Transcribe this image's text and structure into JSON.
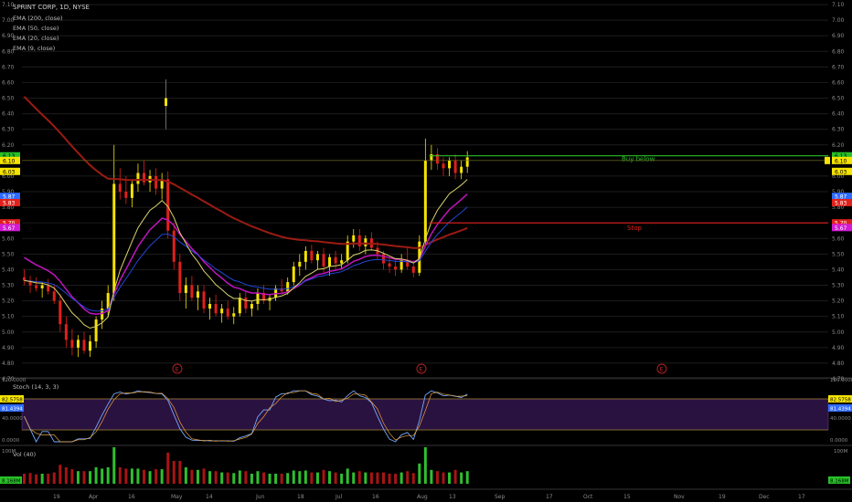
{
  "header": {
    "title": "SPRINT CORP, 1D, NYSE",
    "indicators": [
      "EMA (200, close)",
      "EMA (50, close)",
      "EMA (20, close)",
      "EMA (9, close)"
    ]
  },
  "price_axis": {
    "ticks": [
      "7.10",
      "7.00",
      "6.90",
      "6.80",
      "6.70",
      "6.60",
      "6.50",
      "6.40",
      "6.30",
      "6.20",
      "6.10",
      "6.00",
      "5.90",
      "5.80",
      "5.70",
      "5.60",
      "5.50",
      "5.40",
      "5.30",
      "5.20",
      "5.10",
      "5.00",
      "4.90",
      "4.80",
      "4.70"
    ],
    "markers": [
      {
        "text": "6.13",
        "color": "#27c127"
      },
      {
        "text": "6.10",
        "color": "#f5e300"
      },
      {
        "text": "6.03",
        "color": "#f5e300"
      },
      {
        "text": "5.87",
        "color": "#2f6bff"
      },
      {
        "text": "5.83",
        "color": "#e0201b"
      },
      {
        "text": "5.70",
        "color": "#e0201b"
      },
      {
        "text": "5.67",
        "color": "#d21bd2"
      }
    ]
  },
  "annotations": {
    "buy": "Buy below",
    "stop": "Stop",
    "earnings": "E"
  },
  "stoch": {
    "label": "Stoch (14, 3, 3)",
    "ticks": [
      "120.0000",
      "40.0000",
      "0.0000"
    ],
    "markers": [
      {
        "text": "82.5758",
        "color": "#f5e300"
      },
      {
        "text": "81.4394",
        "color": "#2f6bff"
      }
    ]
  },
  "volume": {
    "label": "Vol (40)",
    "ticks": [
      "100M",
      "0"
    ],
    "marker": {
      "text": "8.168M",
      "color": "#27c127"
    }
  },
  "time_axis": [
    "19",
    "Apr",
    "16",
    "May",
    "14",
    "Jun",
    "18",
    "Jul",
    "16",
    "Aug",
    "13",
    "Sep",
    "17",
    "Oct",
    "15",
    "Nov",
    "19",
    "Dec",
    "17"
  ],
  "chart_data": {
    "type": "candlestick",
    "title": "SPRINT CORP, 1D, NYSE",
    "ylim": [
      4.7,
      7.1
    ],
    "levels": [
      {
        "name": "Buy below",
        "value": 6.13
      },
      {
        "name": "Stop",
        "value": 5.7
      }
    ],
    "ema_last": {
      "EMA 200": 5.83,
      "EMA 50": 5.67,
      "EMA 20": 5.87,
      "EMA 9": 6.03
    },
    "candles_ohlc": [
      [
        5.35,
        5.4,
        5.3,
        5.33
      ],
      [
        5.33,
        5.36,
        5.25,
        5.3
      ],
      [
        5.3,
        5.35,
        5.26,
        5.28
      ],
      [
        5.28,
        5.32,
        5.22,
        5.3
      ],
      [
        5.3,
        5.34,
        5.24,
        5.26
      ],
      [
        5.26,
        5.3,
        5.18,
        5.2
      ],
      [
        5.2,
        5.24,
        5.0,
        5.05
      ],
      [
        5.05,
        5.1,
        4.9,
        4.95
      ],
      [
        4.95,
        5.02,
        4.85,
        4.9
      ],
      [
        4.9,
        4.98,
        4.84,
        4.95
      ],
      [
        4.95,
        5.0,
        4.86,
        4.88
      ],
      [
        4.88,
        4.98,
        4.84,
        4.94
      ],
      [
        4.94,
        5.1,
        4.9,
        5.08
      ],
      [
        5.08,
        5.2,
        5.02,
        5.15
      ],
      [
        5.15,
        5.3,
        5.1,
        5.25
      ],
      [
        5.25,
        6.2,
        5.2,
        5.95
      ],
      [
        5.95,
        6.05,
        5.85,
        5.9
      ],
      [
        5.9,
        6.0,
        5.82,
        5.86
      ],
      [
        5.86,
        5.98,
        5.8,
        5.95
      ],
      [
        5.95,
        6.08,
        5.9,
        6.02
      ],
      [
        6.02,
        6.1,
        5.94,
        5.96
      ],
      [
        5.96,
        6.04,
        5.9,
        6.0
      ],
      [
        6.0,
        6.05,
        5.88,
        5.92
      ],
      [
        5.92,
        6.02,
        5.85,
        5.98
      ],
      [
        5.98,
        6.03,
        5.6,
        5.65
      ],
      [
        5.65,
        5.7,
        5.4,
        5.45
      ],
      [
        5.45,
        5.5,
        5.2,
        5.25
      ],
      [
        5.25,
        5.35,
        5.15,
        5.3
      ],
      [
        5.3,
        5.36,
        5.2,
        5.22
      ],
      [
        5.22,
        5.3,
        5.14,
        5.26
      ],
      [
        5.26,
        5.3,
        5.12,
        5.15
      ],
      [
        5.15,
        5.22,
        5.08,
        5.18
      ],
      [
        5.18,
        5.24,
        5.1,
        5.12
      ],
      [
        5.12,
        5.18,
        5.06,
        5.15
      ],
      [
        5.15,
        5.2,
        5.08,
        5.1
      ],
      [
        5.1,
        5.16,
        5.05,
        5.12
      ],
      [
        5.12,
        5.25,
        5.1,
        5.22
      ],
      [
        5.22,
        5.26,
        5.12,
        5.15
      ],
      [
        5.15,
        5.2,
        5.1,
        5.18
      ],
      [
        5.18,
        5.28,
        5.14,
        5.25
      ],
      [
        5.25,
        5.3,
        5.18,
        5.2
      ],
      [
        5.2,
        5.24,
        5.14,
        5.22
      ],
      [
        5.22,
        5.3,
        5.2,
        5.28
      ],
      [
        5.28,
        5.34,
        5.24,
        5.26
      ],
      [
        5.26,
        5.35,
        5.24,
        5.32
      ],
      [
        5.32,
        5.45,
        5.3,
        5.42
      ],
      [
        5.42,
        5.5,
        5.36,
        5.45
      ],
      [
        5.45,
        5.55,
        5.4,
        5.52
      ],
      [
        5.52,
        5.56,
        5.44,
        5.46
      ],
      [
        5.46,
        5.52,
        5.4,
        5.5
      ],
      [
        5.5,
        5.54,
        5.38,
        5.42
      ],
      [
        5.42,
        5.5,
        5.36,
        5.48
      ],
      [
        5.48,
        5.52,
        5.4,
        5.44
      ],
      [
        5.44,
        5.5,
        5.4,
        5.46
      ],
      [
        5.46,
        5.62,
        5.44,
        5.58
      ],
      [
        5.58,
        5.66,
        5.54,
        5.62
      ],
      [
        5.62,
        5.66,
        5.52,
        5.55
      ],
      [
        5.55,
        5.62,
        5.5,
        5.6
      ],
      [
        5.6,
        5.64,
        5.52,
        5.54
      ],
      [
        5.54,
        5.58,
        5.46,
        5.5
      ],
      [
        5.5,
        5.52,
        5.4,
        5.44
      ],
      [
        5.44,
        5.48,
        5.38,
        5.42
      ],
      [
        5.42,
        5.46,
        5.36,
        5.4
      ],
      [
        5.4,
        5.5,
        5.38,
        5.46
      ],
      [
        5.46,
        5.54,
        5.4,
        5.42
      ],
      [
        5.42,
        5.46,
        5.35,
        5.38
      ],
      [
        5.38,
        5.62,
        5.36,
        5.58
      ],
      [
        5.58,
        6.24,
        5.56,
        6.1
      ],
      [
        6.1,
        6.2,
        6.04,
        6.14
      ],
      [
        6.14,
        6.18,
        6.04,
        6.08
      ],
      [
        6.08,
        6.12,
        6.0,
        6.05
      ],
      [
        6.05,
        6.12,
        6.0,
        6.1
      ],
      [
        6.1,
        6.14,
        5.98,
        6.02
      ],
      [
        6.02,
        6.1,
        5.98,
        6.06
      ],
      [
        6.06,
        6.16,
        6.02,
        6.12
      ]
    ],
    "spike_candle": [
      6.45,
      6.62,
      6.3,
      6.5
    ]
  }
}
